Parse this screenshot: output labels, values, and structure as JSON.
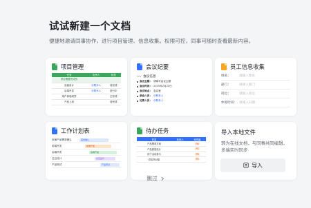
{
  "header": {
    "title": "试试新建一个文档",
    "subtitle": "便捷地邀请同事协作，进行项目管理、信息收集。权限可控，同事可随时查看最新内容。"
  },
  "cards": {
    "project": {
      "title": "项目管理",
      "icon": "sheet-icon",
      "icon_color": "#3ba55c",
      "columns": [
        "任务",
        "负责人",
        "状态"
      ],
      "rows": [
        [
          "项目需要完成的",
          "",
          ""
        ],
        [
          "页面设计",
          "@联系人",
          "待完成"
        ],
        [
          "后端开发",
          "@联系人",
          "进行中"
        ],
        [
          "用户体验研究",
          "",
          "已完成"
        ],
        [
          "产品上线",
          "",
          "待完成"
        ]
      ]
    },
    "meeting": {
      "title": "会议纪要",
      "icon": "doc-icon",
      "icon_color": "#3370ff",
      "section1": "一、会议信息",
      "lines": [
        {
          "label": "会议主题：",
          "value": "请填写会议主题"
        },
        {
          "label": "会议时间：",
          "value": "2020年2月20日"
        },
        {
          "label": "会议地点：",
          "value": "会议室"
        },
        {
          "label": "参会人员：",
          "value": "@联系人"
        },
        {
          "label": "记录人员：",
          "value": "@联系人"
        }
      ]
    },
    "employee": {
      "title": "员工信息收集",
      "icon": "form-icon",
      "icon_color": "#f5a623",
      "fields": [
        {
          "label": "姓名：",
          "placeholder": "请输入姓名"
        },
        {
          "label": "部门：",
          "placeholder": "请输入部门"
        },
        {
          "label": "岗位：",
          "placeholder": "请输入岗位"
        },
        {
          "label": "休假时间：",
          "placeholder": "请输入日期"
        }
      ]
    },
    "plan": {
      "title": "工作计划表",
      "icon": "sheet-icon",
      "icon_color": "#3370ff",
      "tasks": [
        "页面产品需求确认",
        "前端开发",
        "后端开发",
        "交互设计",
        "产品测试"
      ],
      "bar_labels": [
        "需求确认",
        "前端开发",
        "后端开发",
        "交互设计",
        "产品测试"
      ],
      "bar_colors": [
        "#dde8ff",
        "#ffe4c7",
        "#d5f0dd",
        "#e7dcff",
        "#dde8ff"
      ]
    },
    "todo": {
      "title": "待办任务",
      "icon": "sheet-icon",
      "icon_color": "#3ba55c",
      "columns": [
        "任务",
        "负责人",
        "优先级"
      ],
      "rows": [
        [
          "产品需求方案",
          "",
          "P0"
        ],
        [
          "产品原型设计",
          "",
          "P1"
        ],
        [
          "线下活动参与",
          "",
          "P0"
        ],
        [
          "供应商对接",
          "",
          "P2"
        ]
      ]
    },
    "import": {
      "title": "导入本地文件",
      "description": "转为在线文档，与同事共同编辑，多端实时同步",
      "button_label": "导入",
      "icon": "upload-icon"
    }
  },
  "footer": {
    "skip_label": "跳过",
    "skip_icon": "chevron-right-icon"
  }
}
